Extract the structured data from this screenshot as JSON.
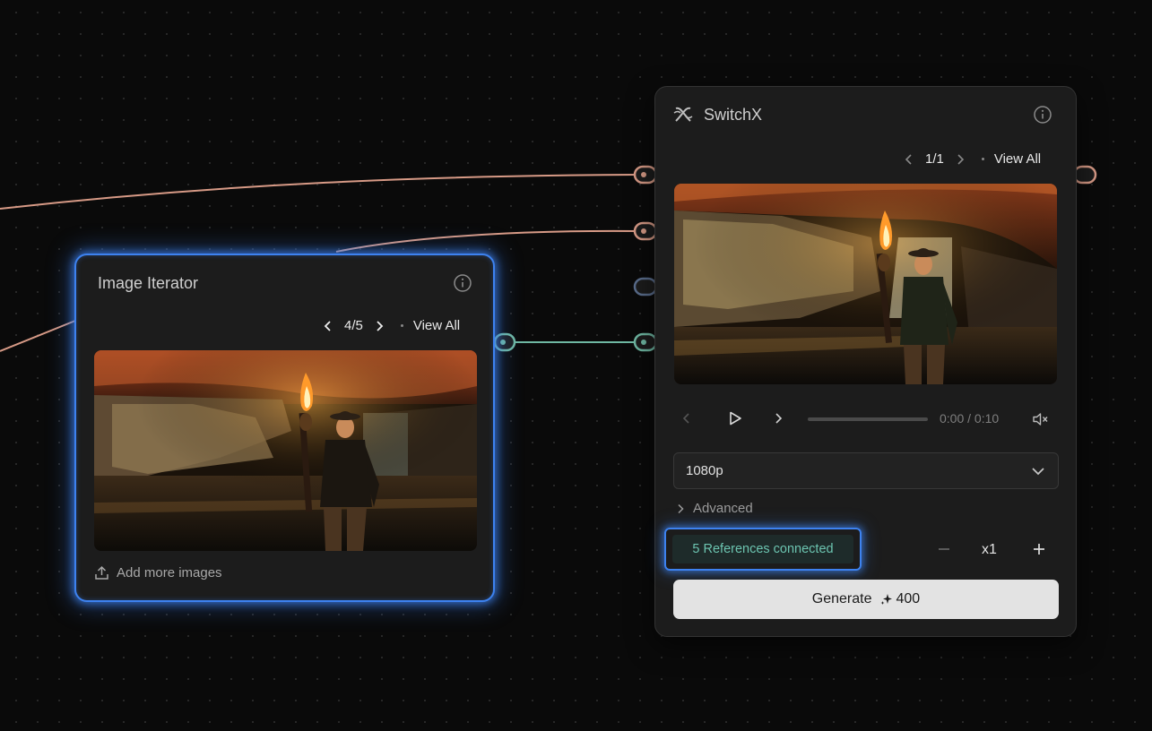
{
  "canvas": {
    "background": "#0a0a0a",
    "wire_colors": {
      "image": "#d79a86",
      "text": "#5a6d8c",
      "ref": "#6fb8a3"
    }
  },
  "image_iterator": {
    "title": "Image Iterator",
    "info_icon": "info-icon",
    "pager": {
      "current": "4/5",
      "view_all": "View All"
    },
    "image_icon": "cave-torch-photo",
    "add_more_label": "Add more images",
    "accent": "#3d82f0"
  },
  "switchx": {
    "title": "SwitchX",
    "logo_icon": "switchx-logo-icon",
    "info_icon": "info-icon",
    "pager": {
      "current": "1/1",
      "view_all": "View All"
    },
    "player": {
      "time": "0:00 / 0:10",
      "progress": 0
    },
    "resolution": {
      "selected": "1080p"
    },
    "advanced_label": "Advanced",
    "references_label": "5 References connected",
    "quantity": "x1",
    "generate": {
      "label": "Generate",
      "cost": "400"
    }
  }
}
